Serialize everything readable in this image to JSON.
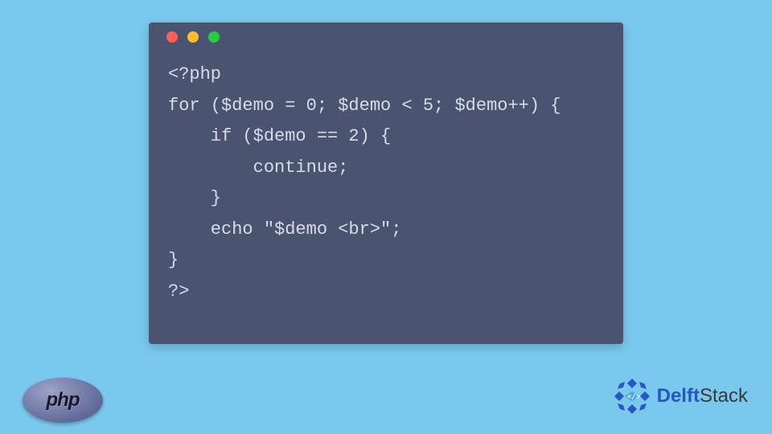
{
  "code": {
    "lines": [
      "<?php",
      "for ($demo = 0; $demo < 5; $demo++) {",
      "    if ($demo == 2) {",
      "        continue;",
      "    }",
      "    echo \"$demo <br>\";",
      "}",
      "?>"
    ]
  },
  "logos": {
    "php_label": "php",
    "delft_prefix": "Delft",
    "delft_suffix": "Stack"
  },
  "colors": {
    "background": "#7ac8ed",
    "window_bg": "#4a5370",
    "code_text": "#d8dbe8",
    "delft_blue": "#2857c4"
  }
}
